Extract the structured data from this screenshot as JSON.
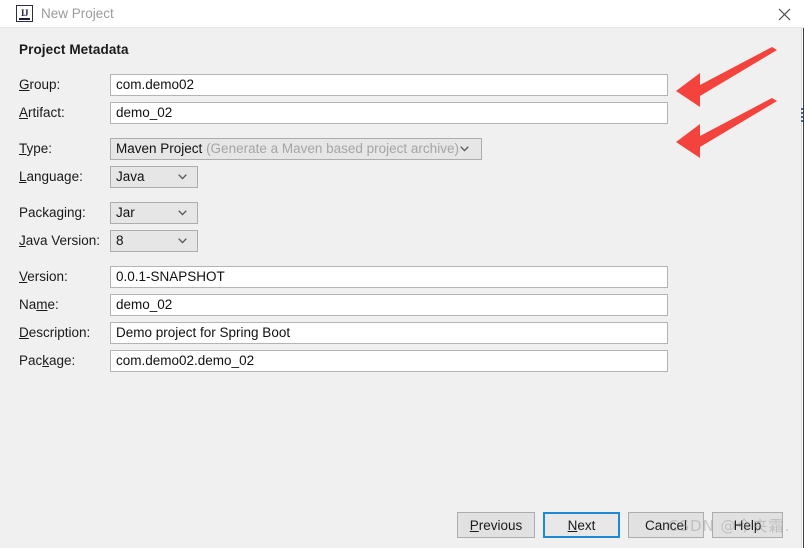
{
  "window": {
    "title": "New Project",
    "app_icon": "intellij-idea-icon",
    "close_icon": "close-icon"
  },
  "section": {
    "heading": "Project Metadata"
  },
  "fields": [
    {
      "label": "Group:",
      "mnemonic": "G",
      "control": "text",
      "value": "com.demo02",
      "name": "group"
    },
    {
      "label": "Artifact:",
      "mnemonic": "A",
      "control": "text",
      "value": "demo_02",
      "name": "artifact"
    },
    {
      "label": "Type:",
      "mnemonic": "T",
      "control": "combo-big",
      "value": "Maven Project",
      "hint": "(Generate a Maven based project archive)",
      "name": "type"
    },
    {
      "label": "Language:",
      "mnemonic": "L",
      "control": "combo-small",
      "value": "Java",
      "name": "language"
    },
    {
      "label": "Packaging:",
      "mnemonic": "g",
      "control": "combo-small",
      "value": "Jar",
      "name": "packaging"
    },
    {
      "label": "Java Version:",
      "mnemonic": "J",
      "control": "combo-small",
      "value": "8",
      "name": "java-version"
    },
    {
      "label": "Version:",
      "mnemonic": "V",
      "control": "text",
      "value": "0.0.1-SNAPSHOT",
      "name": "version"
    },
    {
      "label": "Name:",
      "mnemonic": "m",
      "control": "text",
      "value": "demo_02",
      "name": "name"
    },
    {
      "label": "Description:",
      "mnemonic": "D",
      "control": "text",
      "value": "Demo project for Spring Boot",
      "name": "description"
    },
    {
      "label": "Package:",
      "mnemonic": "k",
      "control": "text",
      "value": "com.demo02.demo_02",
      "name": "package"
    }
  ],
  "labels": {
    "group": "Group:",
    "artifact": "Artifact:",
    "type": "Type:",
    "language": "Language:",
    "packaging": "Packaging:",
    "java_version": "Java Version:",
    "version": "Version:",
    "name": "Name:",
    "description": "Description:",
    "package": "Package:"
  },
  "values": {
    "group": "com.demo02",
    "artifact": "demo_02",
    "type": "Maven Project",
    "type_hint": "(Generate a Maven based project archive)",
    "language": "Java",
    "packaging": "Jar",
    "java_version": "8",
    "version": "0.0.1-SNAPSHOT",
    "name": "demo_02",
    "description": "Demo project for Spring Boot",
    "package": "com.demo02.demo_02"
  },
  "buttons": {
    "previous": "Previous",
    "next": "Next",
    "cancel": "Cancel",
    "help": "Help",
    "focused": "next"
  },
  "annotations": {
    "arrow_color": "#F4433C",
    "arrow_count": 2,
    "arrow_targets": [
      "group-field",
      "artifact-field"
    ]
  },
  "watermark": {
    "text": "CSDN @今夹霜."
  },
  "colors": {
    "titlebar_bg": "#FFFFFF",
    "content_bg": "#F0F0F0",
    "field_bg": "#FFFFFF",
    "field_border": "#B4B4B4",
    "combo_bg": "#E6E6E6",
    "combo_border": "#ADADAD",
    "text": "#1A1A1A",
    "hint_text": "#A5A5A5",
    "title_text": "#9B9B9B",
    "focus_border": "#1E8AD6",
    "accent_red": "#F4433C"
  }
}
